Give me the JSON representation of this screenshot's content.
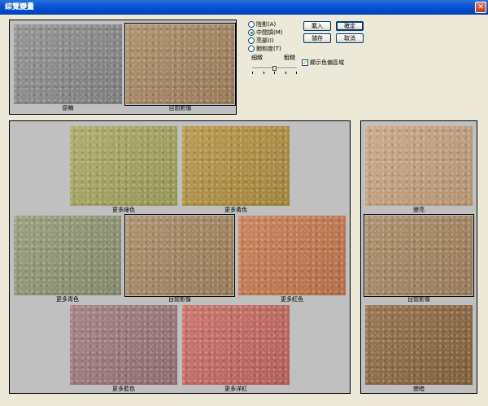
{
  "window": {
    "title": "綜覽變量",
    "close_symbol": "✕"
  },
  "preview": {
    "original_label": "原稿",
    "current_label": "目前影像",
    "original_color": "#8a8a8a",
    "current_color": "#a7865f"
  },
  "tones": {
    "options": [
      {
        "label": "陰影(A)",
        "selected": false
      },
      {
        "label": "中間調(M)",
        "selected": true
      },
      {
        "label": "亮部(I)",
        "selected": false
      },
      {
        "label": "飽和度(T)",
        "selected": false
      }
    ]
  },
  "slider": {
    "fine_label": "細緻",
    "coarse_label": "粗糙",
    "value_fraction": 0.5
  },
  "buttons": {
    "load": "載入",
    "ok": "確定",
    "save": "儲存",
    "cancel": "取消"
  },
  "checkbox": {
    "label": "顯示色偏區域",
    "checked": true
  },
  "variations": [
    {
      "label": "更多綠色",
      "color": "#a6a55f"
    },
    {
      "label": "更多黃色",
      "color": "#b2913f"
    },
    {
      "label": "更多青色",
      "color": "#8f9673"
    },
    {
      "label": "目前影像",
      "color": "#a7865f"
    },
    {
      "label": "更多紅色",
      "color": "#c7774d"
    },
    {
      "label": "更多藍色",
      "color": "#9d7779"
    },
    {
      "label": "更多洋紅",
      "color": "#c56860"
    }
  ],
  "brightness": [
    {
      "label": "變亮",
      "color": "#c6a27d"
    },
    {
      "label": "目前影像",
      "color": "#a7865f"
    },
    {
      "label": "變暗",
      "color": "#8d6740"
    }
  ]
}
